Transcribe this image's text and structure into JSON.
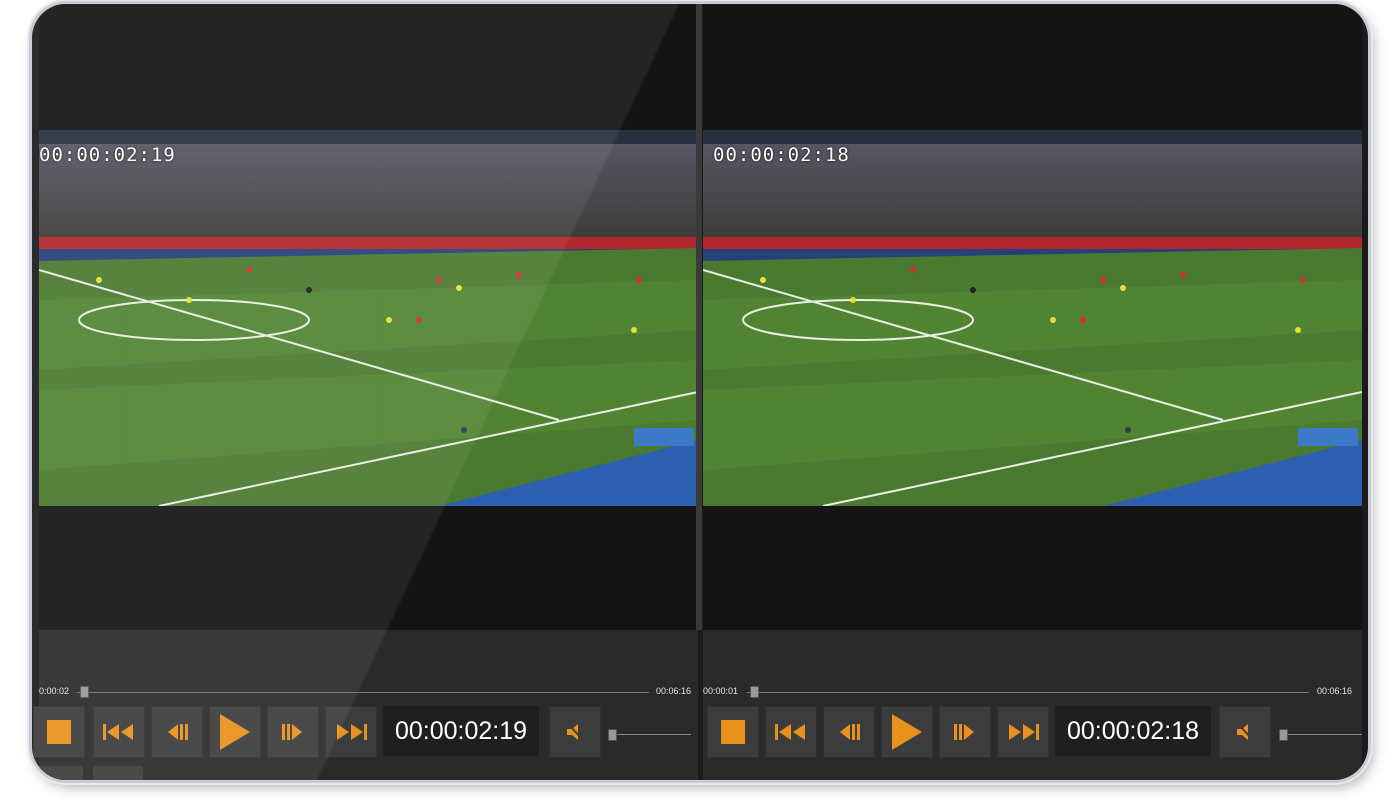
{
  "players": [
    {
      "id": "left",
      "overlay_timecode": "00:00:02:19",
      "seek_current": "0:00:02",
      "seek_total": "00:06:16",
      "progress_fraction": 0.0,
      "timecode_display": "00:00:02:19",
      "muted": true
    },
    {
      "id": "right",
      "overlay_timecode": "00:00:02:18",
      "seek_current": "00:00:01",
      "seek_total": "00:06:16",
      "progress_fraction": 0.0,
      "timecode_display": "00:00:02:18",
      "muted": true
    }
  ],
  "controls": {
    "buttons": [
      "stop-icon",
      "skip-to-start-icon",
      "step-back-icon",
      "play-icon",
      "step-forward-icon",
      "skip-to-end-icon",
      "mute-icon"
    ]
  },
  "colors": {
    "accent": "#e8911c",
    "button_bg": "#3c3c3c",
    "control_bar": "#2a2a2a",
    "pitch": "#4a7a30"
  },
  "video_content": "football match broadcast, wide shot of pitch with stadium crowd"
}
